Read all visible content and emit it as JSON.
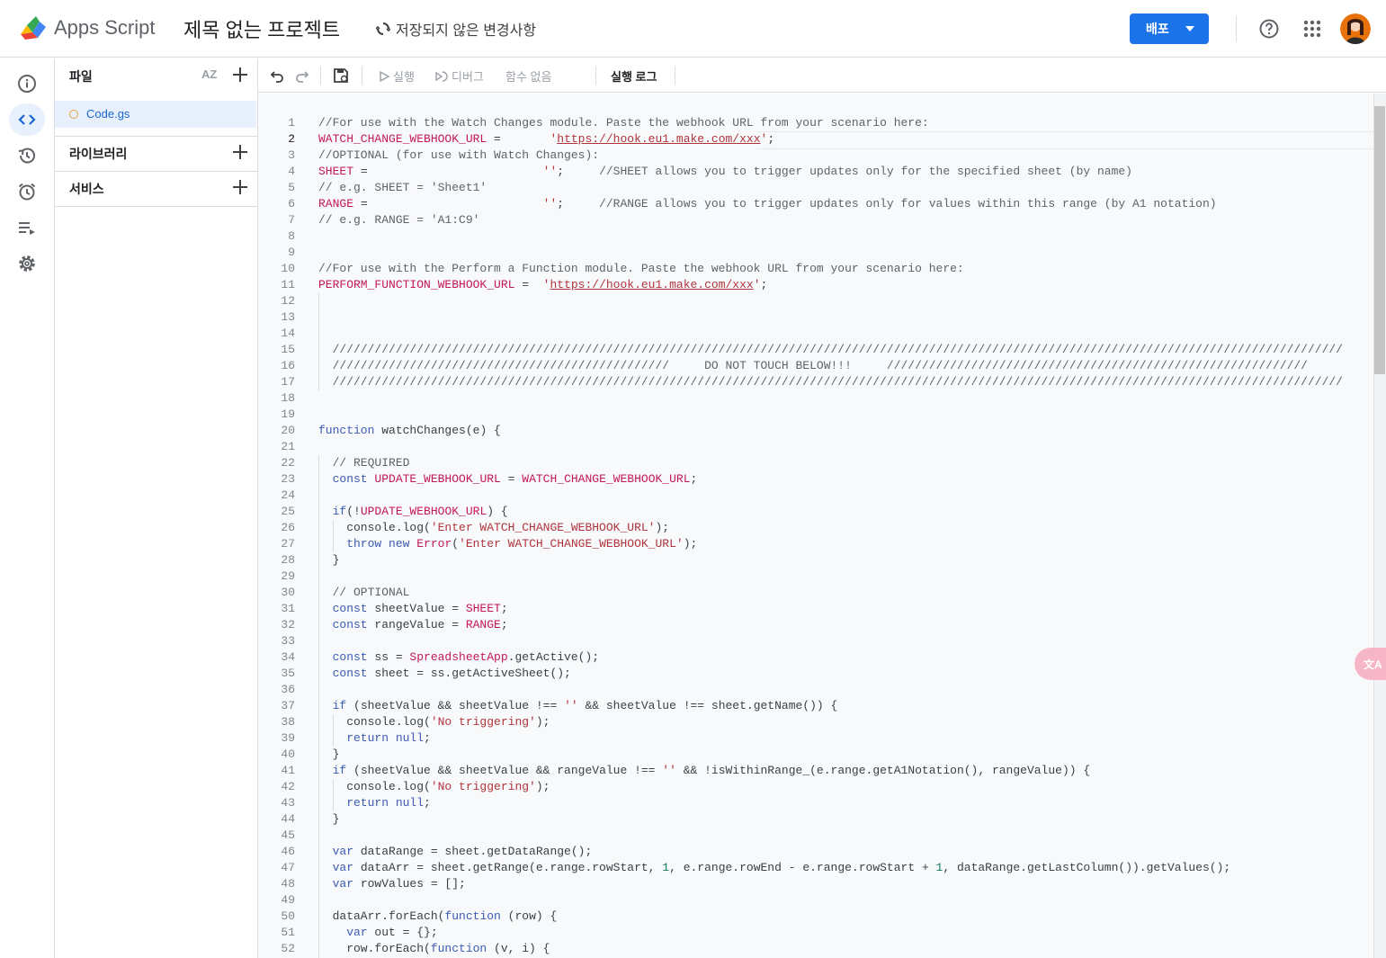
{
  "header": {
    "app_name": "Apps Script",
    "project_title": "제목 없는 프로젝트",
    "unsaved_label": "저장되지 않은 변경사항",
    "deploy_label": "배포",
    "brand_color": "#1a73e8"
  },
  "rail": {
    "items": [
      "info-icon",
      "code-icon",
      "history-icon",
      "triggers-icon",
      "executions-icon",
      "settings-icon"
    ],
    "active_index": 1
  },
  "files_panel": {
    "files_header": "파일",
    "sort_label": "AZ",
    "files": [
      {
        "name": "Code.gs"
      }
    ],
    "libraries_header": "라이브러리",
    "services_header": "서비스"
  },
  "toolbar": {
    "run_label": "실행",
    "debug_label": "디버그",
    "function_label": "함수 없음",
    "log_label": "실행 로그"
  },
  "editor": {
    "current_line": 2,
    "lines": [
      [
        [
          "cm",
          "//For use with the Watch Changes module. Paste the webhook URL from your scenario here:"
        ]
      ],
      [
        [
          "v",
          "WATCH_CHANGE_WEBHOOK_URL"
        ],
        [
          "p",
          " =       "
        ],
        [
          "s",
          "'"
        ],
        [
          "u",
          "https://hook.eu1.make.com/xxx"
        ],
        [
          "s",
          "'"
        ],
        [
          "p",
          ";"
        ]
      ],
      [
        [
          "cm",
          "//OPTIONAL (for use with Watch Changes):"
        ]
      ],
      [
        [
          "v",
          "SHEET"
        ],
        [
          "p",
          " =                         "
        ],
        [
          "s",
          "''"
        ],
        [
          "p",
          ";     "
        ],
        [
          "cm",
          "//SHEET allows you to trigger updates only for the specified sheet (by name)"
        ]
      ],
      [
        [
          "cm",
          "// e.g. SHEET = 'Sheet1'"
        ]
      ],
      [
        [
          "v",
          "RANGE"
        ],
        [
          "p",
          " =                         "
        ],
        [
          "s",
          "''"
        ],
        [
          "p",
          ";     "
        ],
        [
          "cm",
          "//RANGE allows you to trigger updates only for values within this range (by A1 notation)"
        ]
      ],
      [
        [
          "cm",
          "// e.g. RANGE = 'A1:C9'"
        ]
      ],
      [],
      [],
      [
        [
          "cm",
          "//For use with the Perform a Function module. Paste the webhook URL from your scenario here:"
        ]
      ],
      [
        [
          "v",
          "PERFORM_FUNCTION_WEBHOOK_URL"
        ],
        [
          "p",
          " =  "
        ],
        [
          "s",
          "'"
        ],
        [
          "u",
          "https://hook.eu1.make.com/xxx"
        ],
        [
          "s",
          "'"
        ],
        [
          "p",
          ";"
        ]
      ],
      [],
      [],
      [],
      [
        [
          "cm",
          "  ////////////////////////////////////////////////////////////////////////////////////////////////////////////////////////////////////////////////"
        ]
      ],
      [
        [
          "cm",
          "  ////////////////////////////////////////////////     DO NOT TOUCH BELOW!!!     ////////////////////////////////////////////////////////////"
        ]
      ],
      [
        [
          "cm",
          "  ////////////////////////////////////////////////////////////////////////////////////////////////////////////////////////////////////////////////"
        ]
      ],
      [],
      [],
      [
        [
          "k",
          "function"
        ],
        [
          "p",
          " watchChanges(e) {"
        ]
      ],
      [],
      [
        [
          "cm",
          "  // REQUIRED"
        ]
      ],
      [
        [
          "k",
          "  const"
        ],
        [
          "p",
          " "
        ],
        [
          "v",
          "UPDATE_WEBHOOK_URL"
        ],
        [
          "p",
          " = "
        ],
        [
          "v",
          "WATCH_CHANGE_WEBHOOK_URL"
        ],
        [
          "p",
          ";"
        ]
      ],
      [],
      [
        [
          "k",
          "  if"
        ],
        [
          "p",
          "(!"
        ],
        [
          "v",
          "UPDATE_WEBHOOK_URL"
        ],
        [
          "p",
          ") {"
        ]
      ],
      [
        [
          "p",
          "    console.log("
        ],
        [
          "s",
          "'Enter WATCH_CHANGE_WEBHOOK_URL'"
        ],
        [
          "p",
          ");"
        ]
      ],
      [
        [
          "k",
          "    throw new"
        ],
        [
          "p",
          " "
        ],
        [
          "v",
          "Error"
        ],
        [
          "p",
          "("
        ],
        [
          "s",
          "'Enter WATCH_CHANGE_WEBHOOK_URL'"
        ],
        [
          "p",
          ");"
        ]
      ],
      [
        [
          "p",
          "  }"
        ]
      ],
      [],
      [
        [
          "cm",
          "  // OPTIONAL"
        ]
      ],
      [
        [
          "k",
          "  const"
        ],
        [
          "p",
          " sheetValue = "
        ],
        [
          "v",
          "SHEET"
        ],
        [
          "p",
          ";"
        ]
      ],
      [
        [
          "k",
          "  const"
        ],
        [
          "p",
          " rangeValue = "
        ],
        [
          "v",
          "RANGE"
        ],
        [
          "p",
          ";"
        ]
      ],
      [],
      [
        [
          "k",
          "  const"
        ],
        [
          "p",
          " ss = "
        ],
        [
          "v",
          "SpreadsheetApp"
        ],
        [
          "p",
          ".getActive();"
        ]
      ],
      [
        [
          "k",
          "  const"
        ],
        [
          "p",
          " sheet = ss.getActiveSheet();"
        ]
      ],
      [],
      [
        [
          "k",
          "  if"
        ],
        [
          "p",
          " (sheetValue && sheetValue !== "
        ],
        [
          "s",
          "''"
        ],
        [
          "p",
          " && sheetValue !== sheet.getName()) {"
        ]
      ],
      [
        [
          "p",
          "    console.log("
        ],
        [
          "s",
          "'No triggering'"
        ],
        [
          "p",
          ");"
        ]
      ],
      [
        [
          "k",
          "    return null"
        ],
        [
          "p",
          ";"
        ]
      ],
      [
        [
          "p",
          "  }"
        ]
      ],
      [
        [
          "k",
          "  if"
        ],
        [
          "p",
          " (sheetValue && sheetValue && rangeValue !== "
        ],
        [
          "s",
          "''"
        ],
        [
          "p",
          " && !isWithinRange_(e.range.getA1Notation(), rangeValue)) {"
        ]
      ],
      [
        [
          "p",
          "    console.log("
        ],
        [
          "s",
          "'No triggering'"
        ],
        [
          "p",
          ");"
        ]
      ],
      [
        [
          "k",
          "    return null"
        ],
        [
          "p",
          ";"
        ]
      ],
      [
        [
          "p",
          "  }"
        ]
      ],
      [],
      [
        [
          "k",
          "  var"
        ],
        [
          "p",
          " dataRange = sheet.getDataRange();"
        ]
      ],
      [
        [
          "k",
          "  var"
        ],
        [
          "p",
          " dataArr = sheet.getRange(e.range.rowStart, "
        ],
        [
          "n",
          "1"
        ],
        [
          "p",
          ", e.range.rowEnd - e.range.rowStart + "
        ],
        [
          "n",
          "1"
        ],
        [
          "p",
          ", dataRange.getLastColumn()).getValues();"
        ]
      ],
      [
        [
          "k",
          "  var"
        ],
        [
          "p",
          " rowValues = [];"
        ]
      ],
      [],
      [
        [
          "p",
          "  dataArr.forEach("
        ],
        [
          "k",
          "function"
        ],
        [
          "p",
          " (row) {"
        ]
      ],
      [
        [
          "k",
          "    var"
        ],
        [
          "p",
          " out = {};"
        ]
      ],
      [
        [
          "p",
          "    row.forEach("
        ],
        [
          "k",
          "function"
        ],
        [
          "p",
          " (v, i) {"
        ]
      ]
    ]
  }
}
